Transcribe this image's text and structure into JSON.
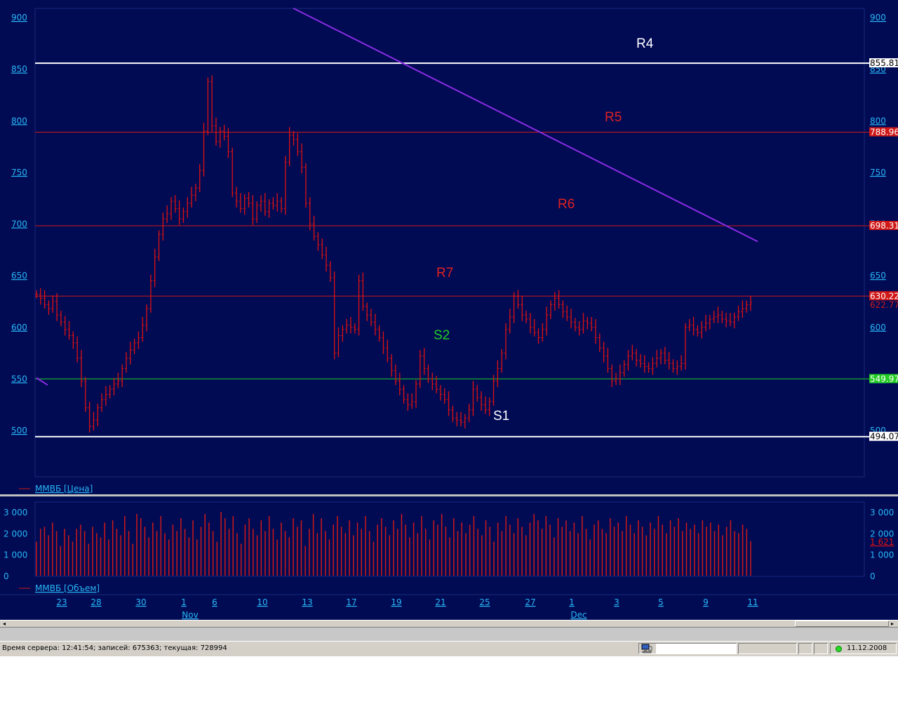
{
  "price_panel": {
    "legend_label": "ММВБ [Цена]",
    "y_ticks": [
      900,
      850,
      800,
      750,
      700,
      650,
      600,
      550,
      500
    ],
    "y_range": [
      470,
      910
    ],
    "levels": [
      {
        "name": "R4",
        "value": 855.81,
        "label": "855.81",
        "color": "#ffffff"
      },
      {
        "name": "R5",
        "value": 788.96,
        "label": "788.96",
        "color": "#d01818"
      },
      {
        "name": "R6",
        "value": 698.31,
        "label": "698.31",
        "color": "#d01818"
      },
      {
        "name": "R7",
        "value": 630.22,
        "label": "630.22",
        "color": "#d01818"
      },
      {
        "name": "S2",
        "value": 549.97,
        "label": "549.97",
        "color": "#22cc22"
      },
      {
        "name": "S1",
        "value": 494.07,
        "label": "494.07",
        "color": "#ffffff"
      }
    ],
    "zone_labels": [
      {
        "text": "R4",
        "color": "#ffffff"
      },
      {
        "text": "R5",
        "color": "#e02020"
      },
      {
        "text": "R6",
        "color": "#e02020"
      },
      {
        "text": "R7",
        "color": "#e02020"
      },
      {
        "text": "S2",
        "color": "#22cc22"
      },
      {
        "text": "S1",
        "color": "#ffffff"
      }
    ],
    "last_price_label": "622.77",
    "trendline": {
      "color": "#8a2be2",
      "from_value": 909,
      "to_value": 683
    }
  },
  "volume_panel": {
    "legend_label": "ММВБ [Объем]",
    "y_ticks": [
      "3 000",
      "2 000",
      "1 000",
      "0"
    ],
    "right_ticks": [
      "3 000",
      "2 000",
      "1 000",
      "0"
    ],
    "last_volume_label": "1 621",
    "y_max": 3000
  },
  "x_axis": {
    "day_labels": [
      "23",
      "28",
      "30",
      "1",
      "6",
      "10",
      "13",
      "17",
      "19",
      "21",
      "25",
      "27",
      "1",
      "3",
      "5",
      "9",
      "11"
    ],
    "month_labels": [
      "Nov",
      "Dec"
    ]
  },
  "chart_data": {
    "type": "bar",
    "title": "",
    "series": [
      {
        "name": "ММВБ [Цена]",
        "kind": "price-bars",
        "values": [
          632,
          628,
          622,
          618,
          625,
          612,
          605,
          598,
          592,
          585,
          570,
          548,
          522,
          504,
          510,
          522,
          530,
          535,
          540,
          545,
          548,
          560,
          570,
          578,
          585,
          590,
          602,
          618,
          645,
          668,
          690,
          705,
          710,
          722,
          715,
          705,
          712,
          720,
          728,
          735,
          752,
          790,
          838,
          795,
          780,
          790,
          785,
          770,
          730,
          722,
          715,
          725,
          720,
          705,
          718,
          722,
          712,
          720,
          718,
          722,
          715,
          760,
          786,
          782,
          770,
          755,
          720,
          700,
          688,
          680,
          670,
          660,
          648,
          575,
          592,
          598,
          602,
          600,
          598,
          645,
          620,
          612,
          605,
          598,
          590,
          580,
          570,
          558,
          548,
          540,
          530,
          525,
          528,
          545,
          572,
          560,
          550,
          545,
          540,
          535,
          530,
          520,
          512,
          510,
          508,
          512,
          520,
          540,
          532,
          525,
          520,
          528,
          548,
          560,
          575,
          598,
          610,
          630,
          622,
          612,
          608,
          600,
          595,
          590,
          598,
          612,
          622,
          628,
          622,
          615,
          610,
          605,
          600,
          598,
          606,
          604,
          600,
          590,
          580,
          572,
          560,
          548,
          550,
          556,
          564,
          572,
          575,
          568,
          565,
          562,
          560,
          565,
          570,
          575,
          568,
          565,
          560,
          562,
          565,
          600,
          602,
          598,
          595,
          600,
          604,
          608,
          610,
          612,
          608,
          606,
          605,
          610,
          615,
          618,
          622,
          624
        ]
      },
      {
        "name": "ММВБ [Объем]",
        "kind": "volume",
        "values": [
          1600,
          2200,
          2300,
          1900,
          2500,
          2100,
          1400,
          2200,
          1900,
          1600,
          2200,
          2400,
          2100,
          1500,
          2300,
          2000,
          1800,
          2500,
          1700,
          2600,
          2200,
          1900,
          2800,
          2100,
          1500,
          2900,
          2700,
          2300,
          1800,
          2500,
          2100,
          2800,
          2000,
          1700,
          2400,
          2100,
          2700,
          2200,
          1800,
          2600,
          1700,
          2300,
          2900,
          2500,
          2100,
          1600,
          3000,
          2700,
          2200,
          2800,
          2000,
          1500,
          2400,
          2700,
          2200,
          1900,
          2600,
          2100,
          2800,
          2200,
          1700,
          2500,
          2100,
          1800,
          2700,
          2300,
          2600,
          1400,
          2200,
          2900,
          2000,
          2700,
          2100,
          1700,
          2400,
          2800,
          2300,
          2000,
          2600,
          1900,
          2500,
          2200,
          2800,
          2100,
          1600,
          2400,
          2700,
          2300,
          1900,
          2600,
          2200,
          2900,
          2400,
          1800,
          2500,
          2000,
          2800,
          2200,
          1700,
          2600,
          2400,
          2900,
          2300,
          1800,
          2700,
          2100,
          2500,
          2000,
          2400,
          2800,
          2200,
          1900,
          2600,
          2300,
          1600,
          2500,
          2100,
          2800,
          2400,
          2000,
          2700,
          2300,
          1900,
          2500,
          2900,
          2600,
          2200,
          2800,
          2400,
          1800,
          2700,
          2300,
          2600,
          2100,
          2500,
          2000,
          2800,
          2200,
          1700,
          2400,
          2600,
          2200,
          2000,
          2700,
          2300,
          2500,
          2100,
          2800,
          2400,
          2000,
          2600,
          2300,
          1900,
          2500,
          2200,
          2800,
          2400,
          2000,
          2600,
          2300,
          2700,
          2100,
          2500,
          2200,
          2400,
          2000,
          2600,
          2300,
          2500,
          2100,
          2400,
          1900,
          2300,
          2600,
          2100,
          2000,
          2400,
          2200,
          1621
        ]
      }
    ],
    "ylim": [
      470,
      910
    ]
  },
  "statusbar": {
    "server_text": "Время сервера: 12:41:54; записей: 675363; текущая: 728994",
    "date": "11.12.2008"
  }
}
